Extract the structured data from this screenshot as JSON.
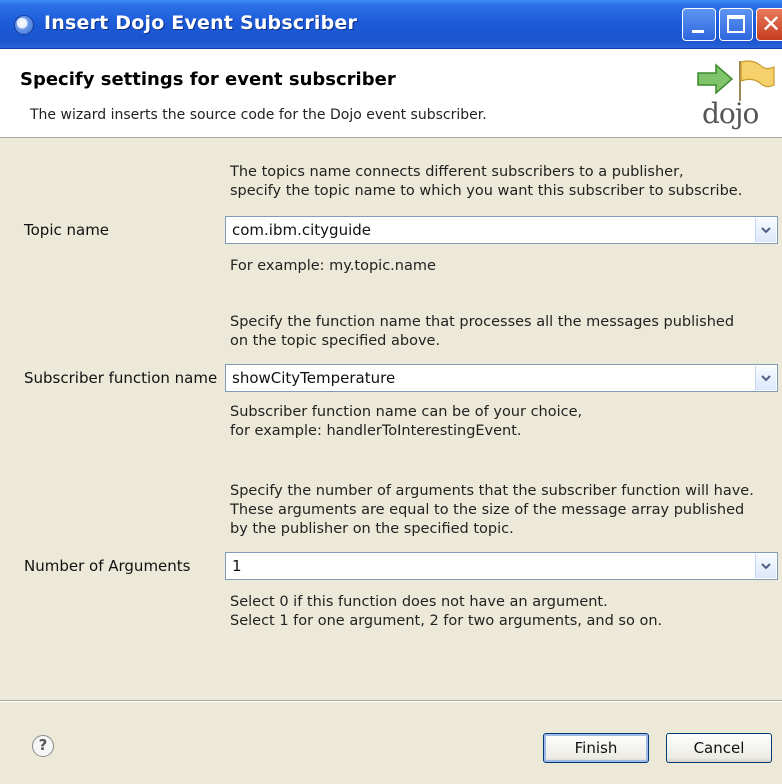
{
  "window": {
    "title": "Insert Dojo Event Subscriber"
  },
  "header": {
    "title": "Specify settings for event subscriber",
    "description": "The wizard inserts the source code for the Dojo event subscriber.",
    "logo_text": "dojo"
  },
  "topic": {
    "help_lines": [
      "The topics name connects different subscribers to a publisher,",
      "specify the topic name to which you want this subscriber to subscribe."
    ],
    "label": "Topic name",
    "value": "com.ibm.cityguide",
    "example": "For example: my.topic.name"
  },
  "subscriber": {
    "help_lines": [
      "Specify the function name that processes all the messages published",
      "on the topic specified above."
    ],
    "label": "Subscriber function name",
    "value": "showCityTemperature",
    "note_lines": [
      "Subscriber function name can be of your choice,",
      "for example: handlerToInterestingEvent."
    ]
  },
  "arguments": {
    "help_lines": [
      "Specify the number of arguments that the subscriber function will have.",
      "These arguments are equal to the size of the message array published",
      "by the publisher on the specified topic."
    ],
    "label": "Number of Arguments",
    "value": "1",
    "note_lines": [
      "Select 0 if this function does not have an argument.",
      "Select 1 for one argument, 2 for two arguments, and so on."
    ]
  },
  "footer": {
    "help_icon": "?",
    "finish_label": "Finish",
    "cancel_label": "Cancel"
  },
  "icons": {
    "title": "app-icon",
    "help": "help-icon",
    "dropdown": "chevron-down-icon",
    "logo": "dojo-logo"
  }
}
